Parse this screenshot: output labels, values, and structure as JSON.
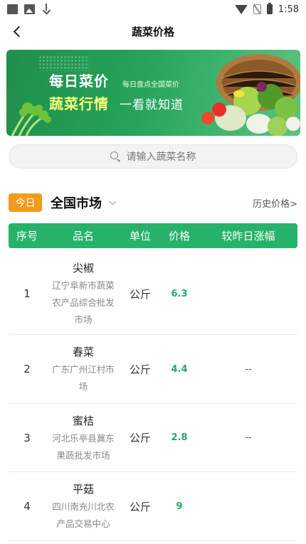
{
  "status_bar": {
    "time": "1:58"
  },
  "nav": {
    "title": "蔬菜价格"
  },
  "banner": {
    "line1": "每日菜价",
    "line1_sub": "每日盘点全国菜价",
    "line2": "蔬菜行情",
    "line2_sub": "一看就知道"
  },
  "search": {
    "placeholder": "请输入蔬菜名称"
  },
  "market": {
    "today_badge": "今日",
    "name": "全国市场",
    "history_link": "历史价格>"
  },
  "table": {
    "headers": {
      "num": "序号",
      "name": "品名",
      "unit": "单位",
      "price": "价格",
      "change": "较昨日涨幅"
    },
    "rows": [
      {
        "num": "1",
        "name": "尖椒",
        "market_lines": [
          "辽宁阜新市蔬菜",
          "农产品综合批发",
          "市场"
        ],
        "unit": "公斤",
        "price": "6.3",
        "change": ""
      },
      {
        "num": "2",
        "name": "春菜",
        "market_lines": [
          "广东广州江村市",
          "场"
        ],
        "unit": "公斤",
        "price": "4.4",
        "change": "--"
      },
      {
        "num": "3",
        "name": "蜜桔",
        "market_lines": [
          "河北乐亭县冀东",
          "果蔬批发市场"
        ],
        "unit": "公斤",
        "price": "2.8",
        "change": "--"
      },
      {
        "num": "4",
        "name": "平菇",
        "market_lines": [
          "四川南充川北农",
          "产品交易中心"
        ],
        "unit": "公斤",
        "price": "9",
        "change": ""
      }
    ]
  },
  "colors": {
    "accent_green": "#27b26a",
    "badge_orange": "#f39b1c",
    "price_green": "#27a866"
  }
}
